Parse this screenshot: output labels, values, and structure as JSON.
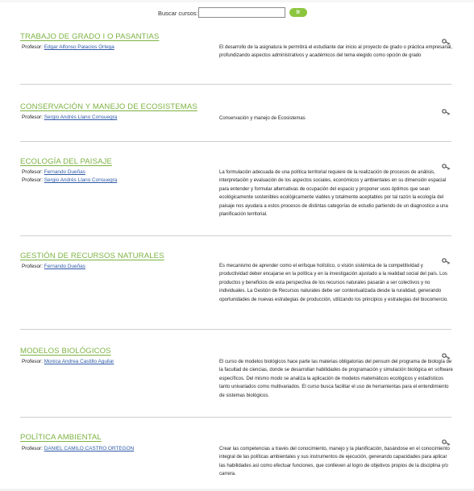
{
  "search": {
    "label": "Buscar cursos:",
    "value": "",
    "button": "Ir"
  },
  "prof_label": "Profesor:",
  "icons": {
    "key": "key-icon"
  },
  "colors": {
    "title_green": "#7cb342",
    "button_green": "#8cc63f",
    "link_blue": "#2e5aa8"
  },
  "courses": [
    {
      "title": "TRABAJO DE GRADO I O PASANTIAS",
      "professors": [
        "Edgar Alfonso Palacios Ortega"
      ],
      "description": "El desarrollo de la asignatura le permitirá  el estudiante dar inicio al proyecto de grado o práctica empresarial,  profundizando aspectos administrativos y académicos del tema elegido  como opción de grado"
    },
    {
      "title": "CONSERVACIÓN Y MANEJO DE ECOSISTEMAS",
      "professors": [
        "Sergio Andrés Llano Consuegra"
      ],
      "description": "Conservación y manejo de Ecosistemas"
    },
    {
      "title": "ECOLOGÍA DEL PAISAJE",
      "professors": [
        "Fernando Dueñas",
        "Sergio Andrés Llano Consuegra"
      ],
      "description": "La formulación adecuada de una política territorial requiere de la realización de procesos de análisis, interpretación y evaluación de los aspectos sociales, económicos y ambientales en su dimensión espacial para entender y formular alternativas de ocupación del espacio y proponer usos óptimos que sean ecológicamente sostenibles ecológicamente viables y totalmente aceptables por tal razón la ecología del paisaje nos ayudara a estos procesos de distintas categorías de estudio partiendo de un diagnostico a una planificación territorial."
    },
    {
      "title": "GESTIÓN DE RECURSOS NATURALES",
      "professors": [
        "Fernando Dueñas"
      ],
      "description": "Es  mecanismo de  aprender  como  el enfoque holístico, o visión sistémica de la competitividad y productividad deber encajarse en la  política y en la  investigación  ajustado a la realidad social del país. Los productos y  beneficios  de esta perspectiva de los recursos naturales  pasarán a ser colectivos y no individuales. La Gestión de  Recursos naturales  debe ser   contextualizada desde la ruralidad, generando oportunidades  de nuevas estrategias de producción, utilizando los principios  y  estrategias del biocomercio."
    },
    {
      "title": "MODELOS BIOLÓGICOS",
      "professors": [
        "Monica Andrea Castillo Aguilar"
      ],
      "description": "El curso de modelos biológicos hace parte las materias obligatorias del pensum del programa de biología de la facultad de ciencias, donde se desarrollan habilidades de programación y simulación biológica en software específicos. Del mismo modo se analiza la aplicación de modelos matemáticos ecológicos y estadísticos tanto univariados como multivariados. El curso busca facilitar el uso de herramientas para el entendimiento de sistemas biológicos."
    },
    {
      "title": "POLÍTICA AMBIENTAL",
      "professors": [
        "DANIEL CAMILO CASTRO ORTEGON"
      ],
      "description": "Crear las competencias a través del conocimiento, manejo y la planificación, basándose en el conocimiento integral de las políticas ambientales y sus instrumentos de ejecución, generando capacidades para aplicar las habilidades así como efectuar funciones, que conlleven al logro de objetivos propios de la disciplina y/o carrera."
    }
  ]
}
